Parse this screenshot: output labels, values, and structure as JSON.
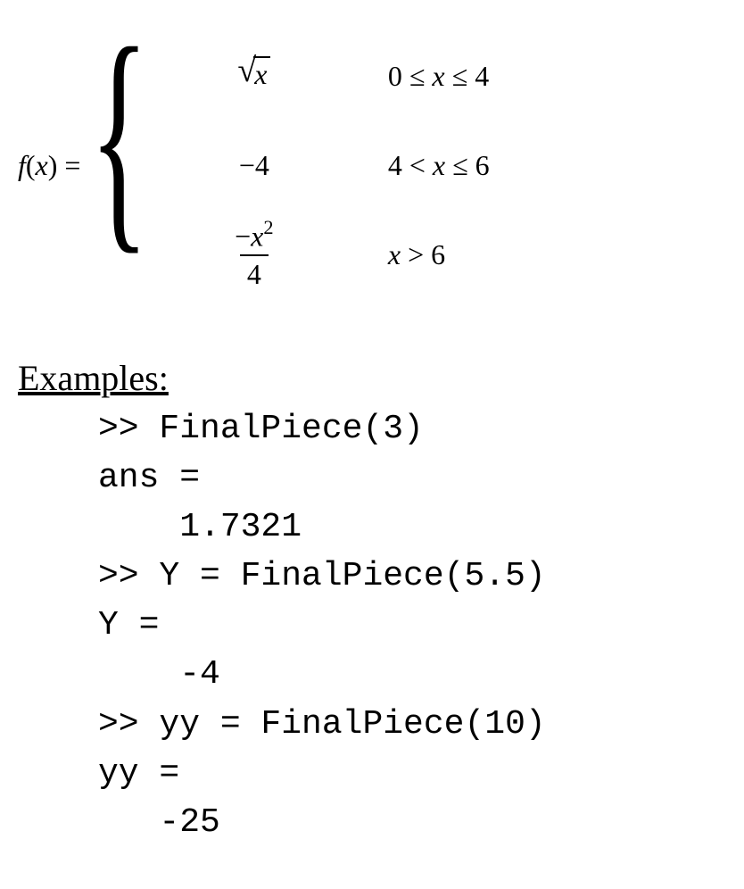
{
  "equation": {
    "func_label_f": "f",
    "func_label_paren_open": "(",
    "func_label_x": "x",
    "func_label_paren_close": ")",
    "equals": " = ",
    "cases": [
      {
        "expr_type": "sqrt",
        "radicand": "x",
        "condition": "0 ≤ x ≤ 4"
      },
      {
        "expr_type": "plain",
        "value": "−4",
        "condition": "4 < x ≤ 6"
      },
      {
        "expr_type": "frac",
        "numerator_pre": "−",
        "numerator_var": "x",
        "numerator_sup": "2",
        "denominator": "4",
        "condition": "x > 6"
      }
    ]
  },
  "examples": {
    "heading": "Examples:",
    "lines": [
      ">> FinalPiece(3)",
      "ans =",
      "    1.7321",
      ">> Y = FinalPiece(5.5)",
      "Y =",
      "    -4",
      ">> yy = FinalPiece(10)",
      "yy =",
      "   -25"
    ]
  }
}
